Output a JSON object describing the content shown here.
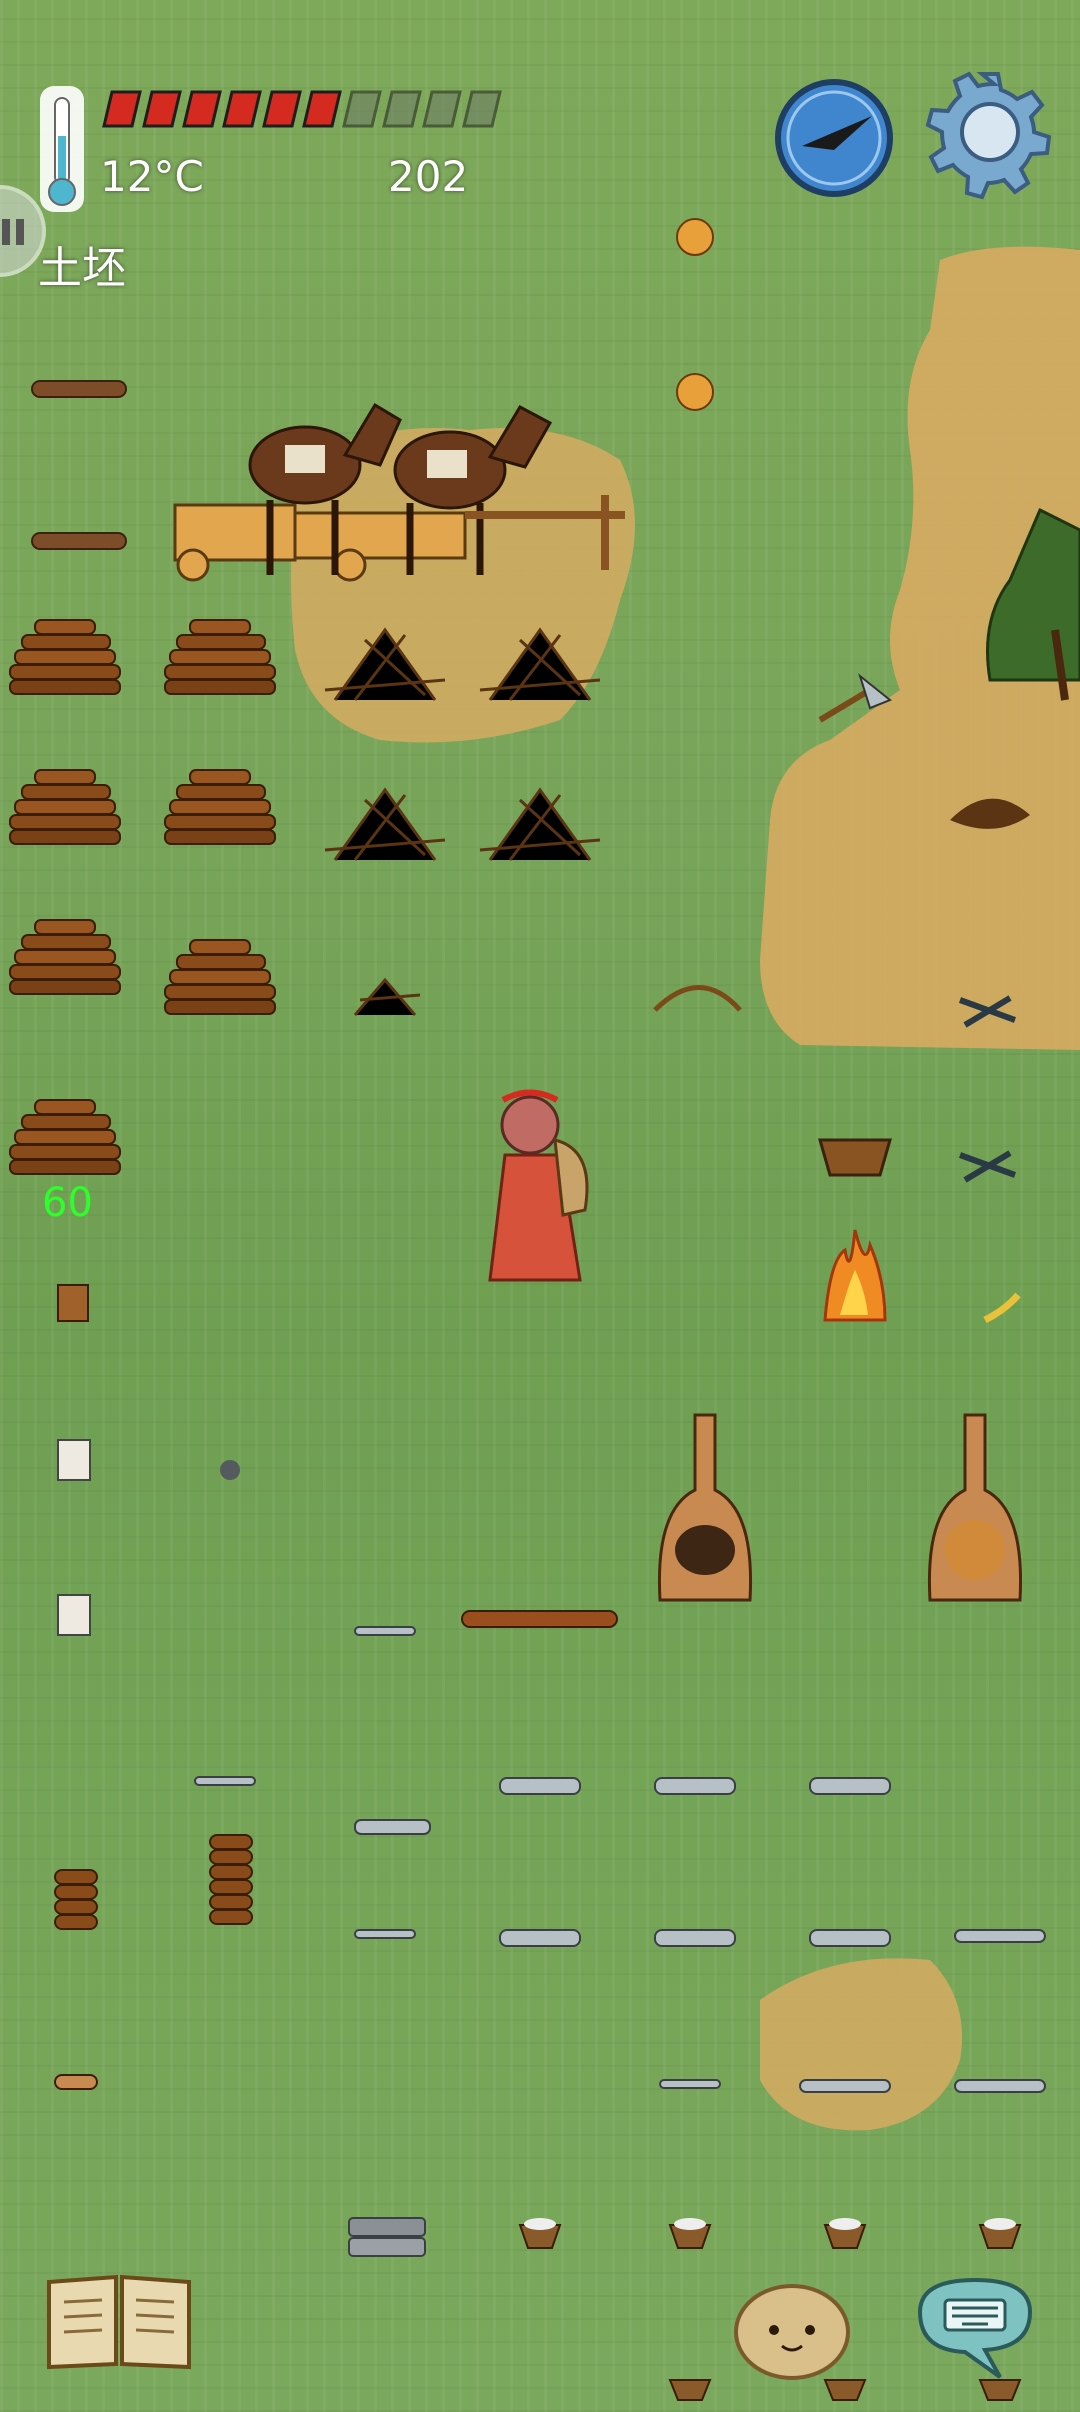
{
  "hud": {
    "temperature": "12°C",
    "food_meter": {
      "filled_pips": 6,
      "total_pips": 10
    },
    "counter": "202",
    "held_object": "土坯",
    "nearby_number": "60"
  },
  "icons": {
    "thermometer": "thermometer-icon",
    "compass": "compass-icon",
    "settings": "gear-icon",
    "tech_tree": "book-icon",
    "emote": "face-emote-icon",
    "chat": "keyboard-chat-icon",
    "pause": "pause-icon"
  },
  "colors": {
    "grass": "#76a558",
    "dirt": "#d9a85c",
    "food_pip_filled": "#d42a20",
    "food_pip_empty": "#6d7a66",
    "compass_face": "#3f86cf",
    "gear": "#7aa9cf",
    "number_green": "#2cff2c"
  }
}
